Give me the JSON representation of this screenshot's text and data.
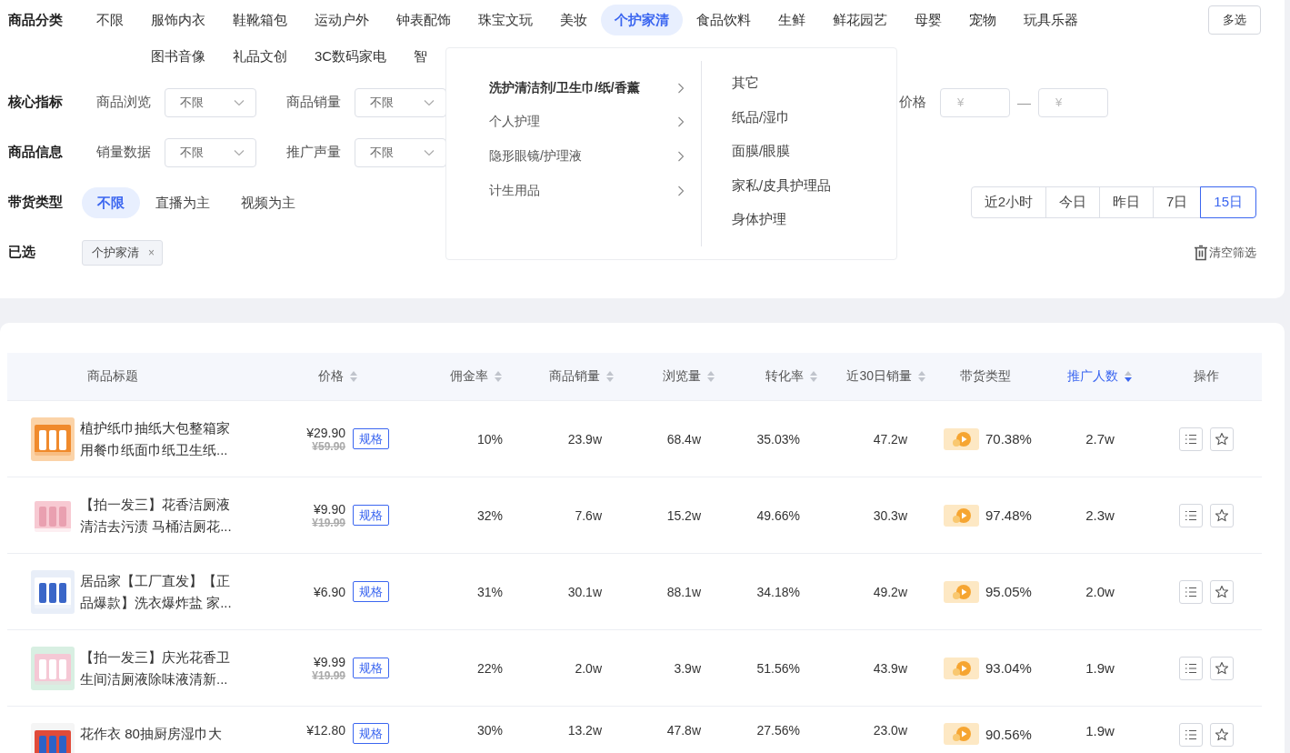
{
  "category_filter": {
    "label": "商品分类",
    "items": [
      {
        "label": "不限",
        "selected": false
      },
      {
        "label": "服饰内衣",
        "selected": false
      },
      {
        "label": "鞋靴箱包",
        "selected": false
      },
      {
        "label": "运动户外",
        "selected": false
      },
      {
        "label": "钟表配饰",
        "selected": false
      },
      {
        "label": "珠宝文玩",
        "selected": false
      },
      {
        "label": "美妆",
        "selected": false
      },
      {
        "label": "个护家清",
        "selected": true
      },
      {
        "label": "食品饮料",
        "selected": false
      },
      {
        "label": "生鲜",
        "selected": false
      },
      {
        "label": "鲜花园艺",
        "selected": false
      },
      {
        "label": "母婴",
        "selected": false
      },
      {
        "label": "宠物",
        "selected": false
      },
      {
        "label": "玩具乐器",
        "selected": false
      },
      {
        "label": "图书音像",
        "selected": false
      },
      {
        "label": "礼品文创",
        "selected": false
      },
      {
        "label": "3C数码家电",
        "selected": false
      },
      {
        "label": "智",
        "selected": false
      }
    ],
    "multi_select_button": "多选"
  },
  "category_menu": {
    "groups": [
      {
        "label": "洗护清洁剂/卫生巾/纸/香薰",
        "selected": true
      },
      {
        "label": "个人护理",
        "selected": false
      },
      {
        "label": "隐形眼镜/护理液",
        "selected": false
      },
      {
        "label": "计生用品",
        "selected": false
      }
    ],
    "subitems": [
      "其它",
      "纸品/湿巾",
      "面膜/眼膜",
      "家私/皮具护理品",
      "身体护理"
    ]
  },
  "core_metrics": {
    "label": "核心指标",
    "selects": [
      {
        "label": "商品浏览",
        "value": "不限"
      },
      {
        "label": "商品销量",
        "value": "不限"
      }
    ],
    "price": {
      "label": "价格",
      "min_placeholder": "¥",
      "separator": "—",
      "max_placeholder": "¥"
    }
  },
  "product_info": {
    "label": "商品信息",
    "selects": [
      {
        "label": "销量数据",
        "value": "不限"
      },
      {
        "label": "推广声量",
        "value": "不限"
      }
    ]
  },
  "sales_type": {
    "label": "带货类型",
    "options": [
      {
        "label": "不限",
        "selected": true
      },
      {
        "label": "直播为主",
        "selected": false
      },
      {
        "label": "视频为主",
        "selected": false
      }
    ],
    "time_ranges": [
      {
        "label": "近2小时",
        "selected": false
      },
      {
        "label": "今日",
        "selected": false
      },
      {
        "label": "昨日",
        "selected": false
      },
      {
        "label": "7日",
        "selected": false
      },
      {
        "label": "15日",
        "selected": true
      }
    ]
  },
  "selected_filters": {
    "label": "已选",
    "tags": [
      "个护家清"
    ],
    "tag_close": "×",
    "clear_button": "清空筛选"
  },
  "table": {
    "columns": [
      {
        "label": "商品标题"
      },
      {
        "label": "价格",
        "sortable": true,
        "sort_desc": false
      },
      {
        "label": "佣金率",
        "sortable": true,
        "sort_desc": false
      },
      {
        "label": "商品销量",
        "sortable": true,
        "sort_desc": false
      },
      {
        "label": "浏览量",
        "sortable": true,
        "sort_desc": false
      },
      {
        "label": "转化率",
        "sortable": true,
        "sort_desc": false
      },
      {
        "label": "近30日销量",
        "sortable": true,
        "sort_desc": false
      },
      {
        "label": "带货类型"
      },
      {
        "label": "推广人数",
        "sortable": true,
        "sort_desc": true
      },
      {
        "label": "操作"
      }
    ],
    "rows": [
      {
        "title": "植护纸巾抽纸大包整箱家用餐巾纸面巾纸卫生纸...",
        "price": "¥29.90",
        "original_price": "¥59.90",
        "spec": "规格",
        "commission": "10%",
        "sales": "23.9w",
        "views": "68.4w",
        "conversion": "35.03%",
        "sales_30d": "47.2w",
        "video_share": "70.38%",
        "promoters": "2.7w"
      },
      {
        "title": "【拍一发三】花香洁厕液清洁去污渍 马桶洁厕花...",
        "price": "¥9.90",
        "original_price": "¥19.99",
        "spec": "规格",
        "commission": "32%",
        "sales": "7.6w",
        "views": "15.2w",
        "conversion": "49.66%",
        "sales_30d": "30.3w",
        "video_share": "97.48%",
        "promoters": "2.3w"
      },
      {
        "title": "居品家【工厂直发】【正品爆款】洗衣爆炸盐 家...",
        "price": "¥6.90",
        "spec": "规格",
        "commission": "31%",
        "sales": "30.1w",
        "views": "88.1w",
        "conversion": "34.18%",
        "sales_30d": "49.2w",
        "video_share": "95.05%",
        "promoters": "2.0w"
      },
      {
        "title": "【拍一发三】庆光花香卫生间洁厕液除味液清新...",
        "price": "¥9.99",
        "original_price": "¥19.99",
        "spec": "规格",
        "commission": "22%",
        "sales": "2.0w",
        "views": "3.9w",
        "conversion": "51.56%",
        "sales_30d": "43.9w",
        "video_share": "93.04%",
        "promoters": "1.9w"
      },
      {
        "title": "花作衣 80抽厨房湿巾大",
        "price": "¥12.80",
        "spec": "规格",
        "commission": "30%",
        "sales": "13.2w",
        "views": "47.8w",
        "conversion": "27.56%",
        "sales_30d": "23.0w",
        "video_share": "90.56%",
        "promoters": "1.9w"
      }
    ]
  }
}
